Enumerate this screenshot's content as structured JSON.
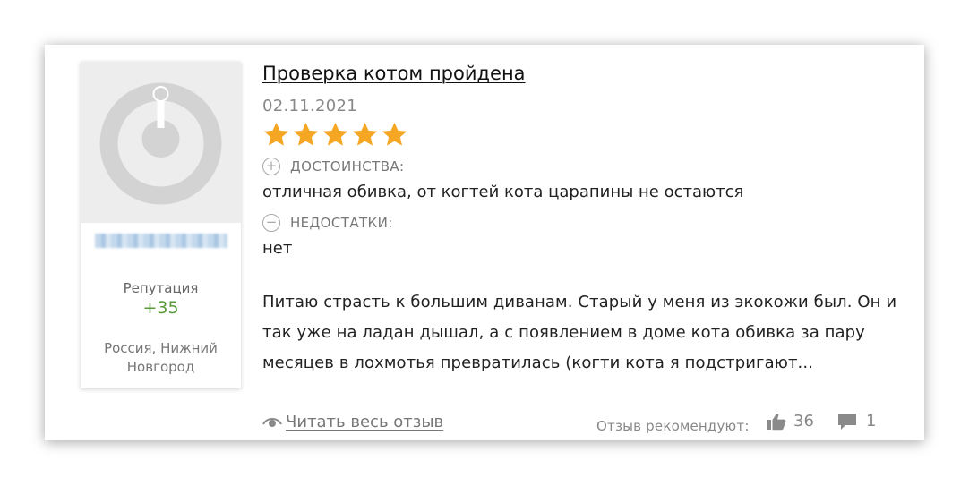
{
  "review": {
    "title": "Проверка котом пройдена",
    "date": "02.11.2021",
    "rating": 5,
    "rating_max": 5,
    "star_color": "#f5a623",
    "pros_label": "ДОСТОИНСТВА:",
    "pros_text": "отличная обивка, от когтей кота царапины не остаются",
    "cons_label": "НЕДОСТАТКИ:",
    "cons_text": "нет",
    "excerpt": "Питаю страсть к большим диванам. Старый у меня из экокожи был. Он и так уже на ладан дышал, а с появлением в доме кота обивка за пару месяцев в лохмотья превратилась (когти кота я подстригают..."
  },
  "author": {
    "reputation_label": "Репутация",
    "reputation_value": "+35",
    "reputation_color": "#5b9a3a",
    "location": "Россия, Нижний Новгород"
  },
  "footer": {
    "read_more_label": "Читать весь отзыв",
    "recommend_label": "Отзыв рекомендуют:",
    "likes_count": "36",
    "comments_count": "1"
  },
  "icons": {
    "pros": "plus-circle-icon",
    "cons": "minus-circle-icon",
    "read_more": "eye-icon",
    "likes": "thumbs-up-icon",
    "comments": "comment-icon"
  }
}
